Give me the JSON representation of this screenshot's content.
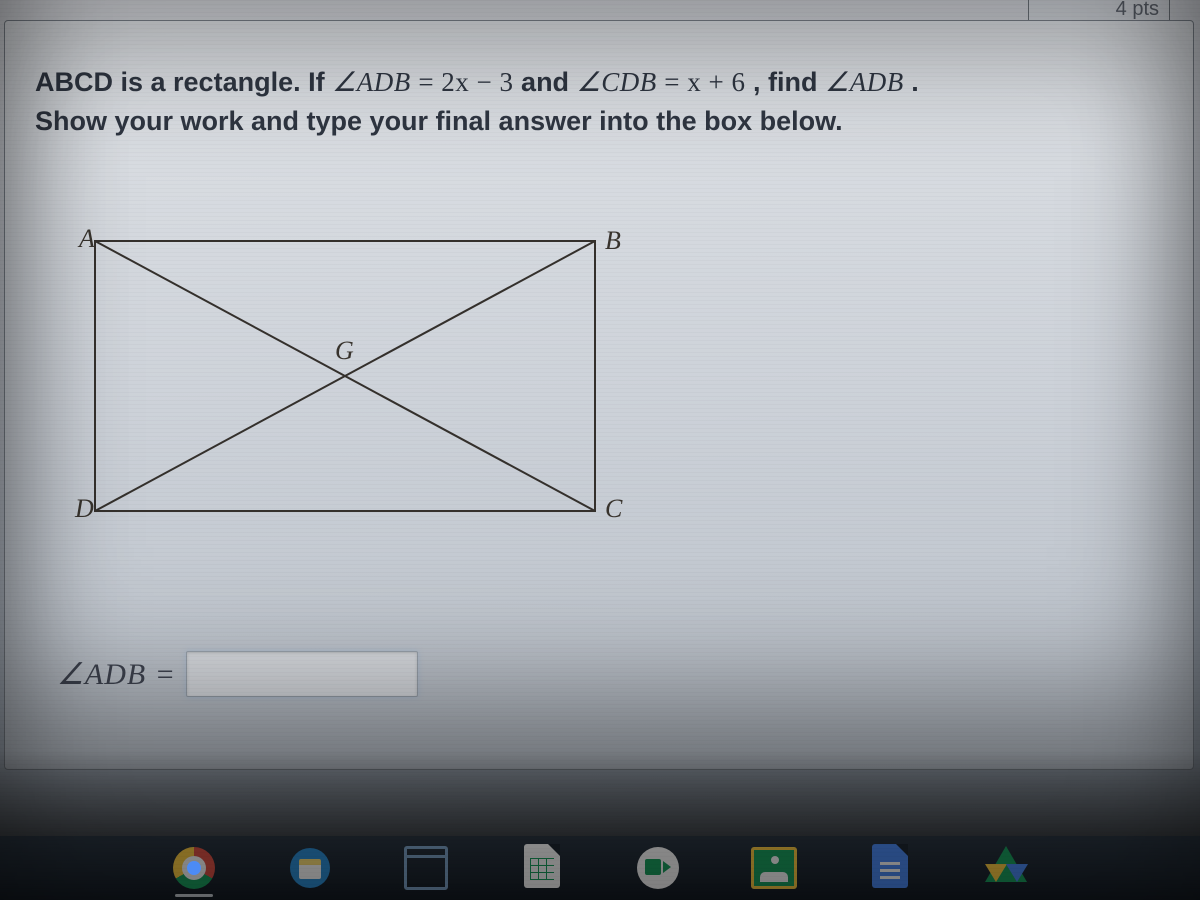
{
  "points_badge": "4 pts",
  "question": {
    "part1": "ABCD is a rectangle.  If ",
    "angle1": "∠ADB",
    "eq1": " = 2x − 3",
    "mid": "  and ",
    "angle2": "∠CDB",
    "eq2": " = x + 6",
    "tail": " , find ",
    "angle3": "∠ADB",
    "period": " .",
    "line2": "Show your work and type your final answer into the box below."
  },
  "figure": {
    "labels": {
      "A": "A",
      "B": "B",
      "C": "C",
      "D": "D",
      "G": "G"
    }
  },
  "answer": {
    "label": "∠ADB =",
    "placeholder": ""
  },
  "taskbar": {
    "items": [
      {
        "name": "chrome-icon"
      },
      {
        "name": "files-icon"
      },
      {
        "name": "window-icon"
      },
      {
        "name": "sheets-icon"
      },
      {
        "name": "meet-icon"
      },
      {
        "name": "classroom-icon"
      },
      {
        "name": "docs-icon"
      },
      {
        "name": "drive-icon"
      }
    ]
  }
}
